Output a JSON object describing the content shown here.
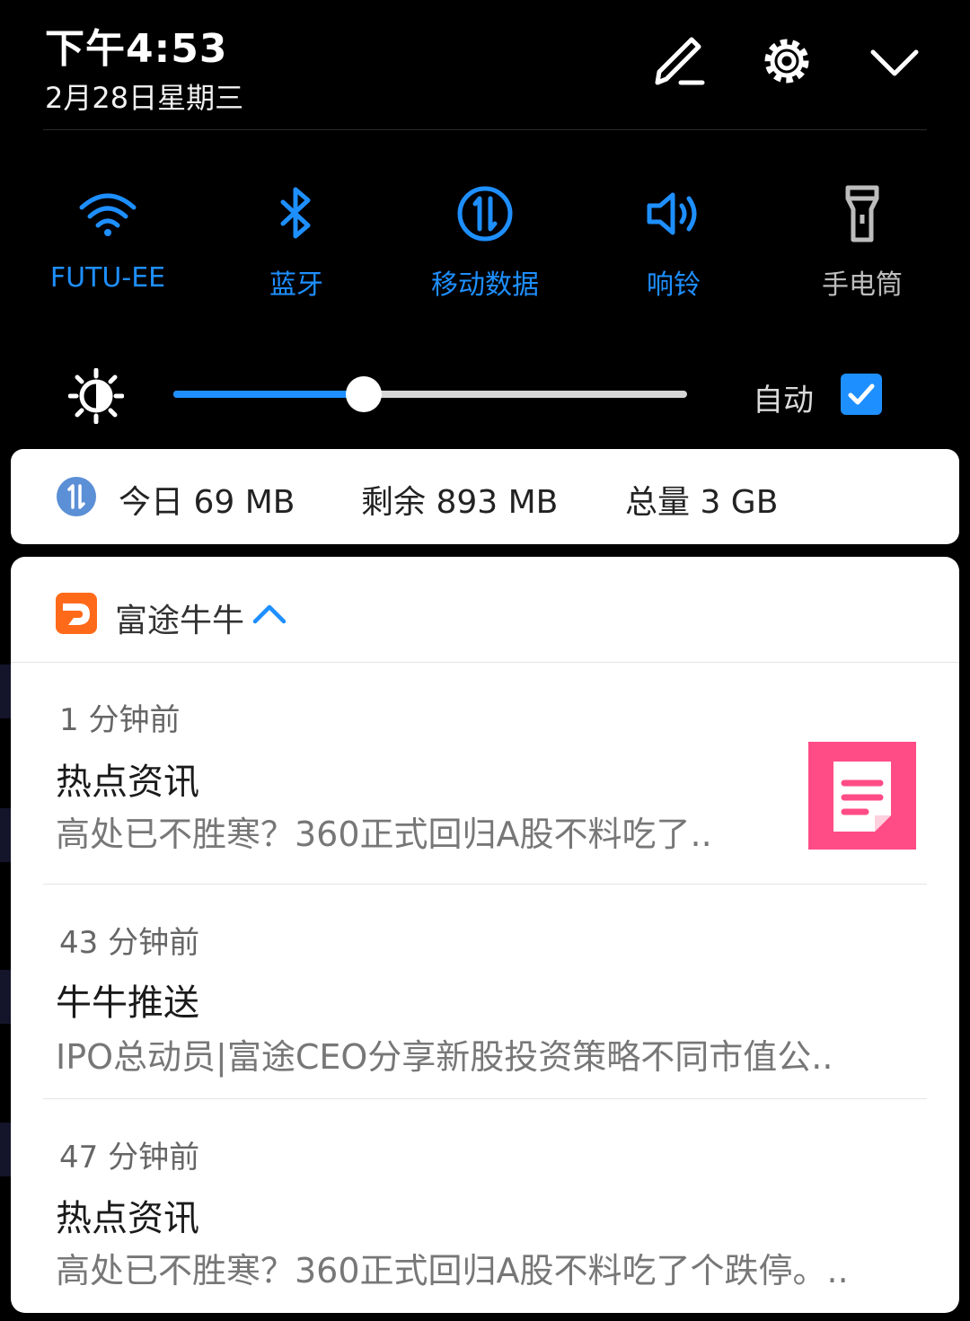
{
  "status": {
    "time": "下午4:53",
    "date": "2月28日星期三",
    "icons": [
      "edit-icon",
      "settings-icon",
      "collapse-chevron-icon"
    ]
  },
  "quick_toggles": [
    {
      "label": "FUTU-EE",
      "icon": "wifi-icon",
      "active": true
    },
    {
      "label": "蓝牙",
      "icon": "bluetooth-icon",
      "active": true
    },
    {
      "label": "移动数据",
      "icon": "mobile-data-icon",
      "active": true
    },
    {
      "label": "响铃",
      "icon": "ring-volume-icon",
      "active": true
    },
    {
      "label": "手电筒",
      "icon": "flashlight-icon",
      "active": false
    }
  ],
  "brightness": {
    "level_percent": 37,
    "auto_label": "自动",
    "auto_checked": true
  },
  "data_usage": {
    "today": "今日 69 MB",
    "remaining": "剩余 893 MB",
    "total": "总量 3 GB"
  },
  "notifications_app": {
    "name": "富途牛牛",
    "items": [
      {
        "time": "1 分钟前",
        "title": "热点资讯",
        "body": "高处已不胜寒？360正式回归A股不料吃了.."
      },
      {
        "time": "43 分钟前",
        "title": "牛牛推送",
        "body": "IPO总动员|富途CEO分享新股投资策略不同市值公.."
      },
      {
        "time": "47 分钟前",
        "title": "热点资讯",
        "body": "高处已不胜寒？360正式回归A股不料吃了个跌停。.."
      }
    ]
  },
  "colors": {
    "accent": "#1e8fff",
    "inactive": "#bdbdbd",
    "brand_orange": "#ff6a1a",
    "thumb_pink": "#ff4c86"
  }
}
